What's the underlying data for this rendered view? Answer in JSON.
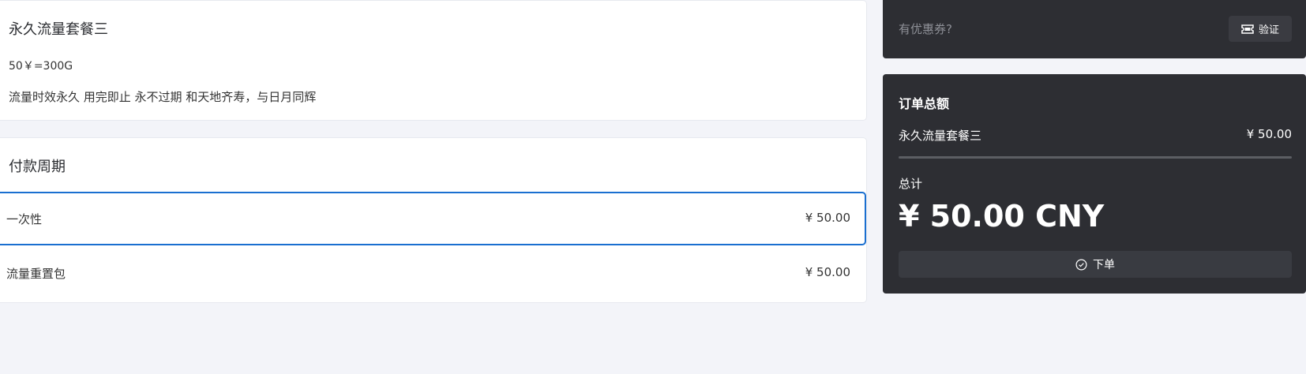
{
  "plan": {
    "title": "永久流量套餐三",
    "price_text": "50￥=300G",
    "description": "流量时效永久 用完即止 永不过期 和天地齐寿，与日月同辉"
  },
  "period": {
    "title": "付款周期",
    "options": [
      {
        "label": "一次性",
        "price": "¥ 50.00",
        "selected": true
      },
      {
        "label": "流量重置包",
        "price": "¥ 50.00",
        "selected": false
      }
    ]
  },
  "coupon": {
    "placeholder": "有优惠券?",
    "verify_label": "验证",
    "icon": "ticket-icon"
  },
  "summary": {
    "title": "订单总额",
    "item_name": "永久流量套餐三",
    "item_price": "¥ 50.00",
    "total_label": "总计",
    "total_value": "¥ 50.00 CNY",
    "order_label": "下单",
    "order_icon": "check-circle-icon"
  },
  "colors": {
    "accent": "#1a6fd0",
    "dark_panel": "#2d2e33",
    "background": "#f3f4f9"
  }
}
